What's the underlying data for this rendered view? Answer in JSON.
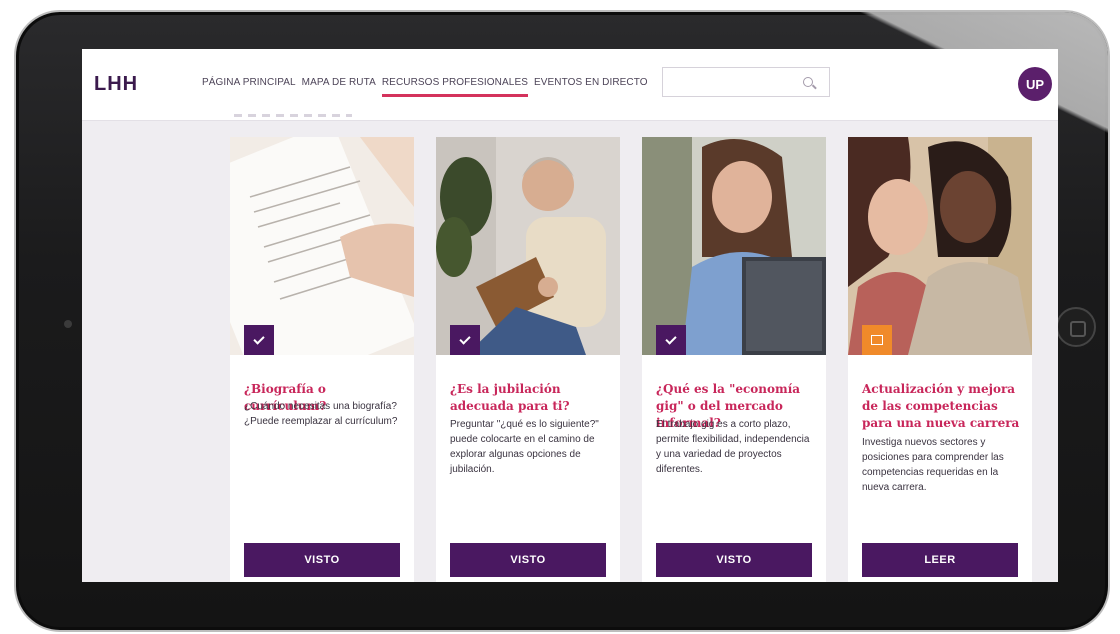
{
  "header": {
    "logo": "LHH",
    "nav": [
      {
        "label": "PÁGINA PRINCIPAL"
      },
      {
        "label": "MAPA DE RUTA"
      },
      {
        "label": "RECURSOS PROFESIONALES"
      },
      {
        "label": "EVENTOS EN DIRECTO"
      }
    ],
    "search_placeholder": "",
    "avatar_initials": "UP"
  },
  "cards": [
    {
      "title": "¿Biografía o currículum?",
      "description": "¿Cuándo necesitas una biografía? ¿Puede reemplazar al currículum?",
      "button": "VISTO",
      "badge": "check-icon"
    },
    {
      "title": "¿Es la jubilación adecuada para ti?",
      "description": "Preguntar \"¿qué es lo siguiente?\" puede colocarte en el camino de explorar algunas opciones de jubilación.",
      "button": "VISTO",
      "badge": "check-icon"
    },
    {
      "title": "¿Qué es la \"economía gig\" o del mercado informal?",
      "description": "El trabajo gig es a corto plazo, permite flexibilidad, independencia y una variedad de proyectos diferentes.",
      "button": "VISTO",
      "badge": "check-icon"
    },
    {
      "title": "Actualización y mejora de las competencias para una nueva carrera",
      "description": "Investiga nuevos sectores y posiciones para comprender las competencias requeridas en la nueva carrera.",
      "button": "LEER",
      "badge": "document-icon"
    }
  ],
  "colors": {
    "brand_purple": "#4a1861",
    "accent_pink": "#c8265a",
    "badge_orange": "#f08a2a"
  }
}
